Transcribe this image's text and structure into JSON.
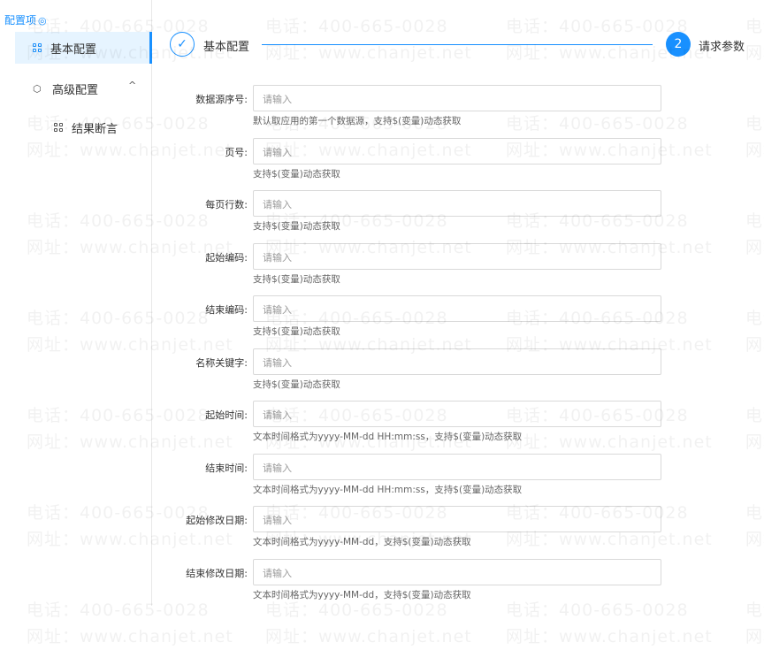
{
  "sidebar": {
    "title": "配置项",
    "items": [
      {
        "label": "基本配置"
      },
      {
        "label": "高级配置"
      },
      {
        "label": "结果断言"
      }
    ]
  },
  "steps": [
    {
      "label": "基本配置",
      "status": "done"
    },
    {
      "number": "2",
      "label": "请求参数",
      "status": "active"
    }
  ],
  "form": {
    "placeholder": "请输入",
    "fields": [
      {
        "label": "数据源序号:",
        "hint": "默认取应用的第一个数据源，支持$(变量)动态获取"
      },
      {
        "label": "页号:",
        "hint": "支持$(变量)动态获取"
      },
      {
        "label": "每页行数:",
        "hint": "支持$(变量)动态获取"
      },
      {
        "label": "起始编码:",
        "hint": "支持$(变量)动态获取"
      },
      {
        "label": "结束编码:",
        "hint": "支持$(变量)动态获取"
      },
      {
        "label": "名称关键字:",
        "hint": "支持$(变量)动态获取"
      },
      {
        "label": "起始时间:",
        "hint": "文本时间格式为yyyy-MM-dd HH:mm:ss，支持$(变量)动态获取"
      },
      {
        "label": "结束时间:",
        "hint": "文本时间格式为yyyy-MM-dd HH:mm:ss，支持$(变量)动态获取"
      },
      {
        "label": "起始修改日期:",
        "hint": "文本时间格式为yyyy-MM-dd，支持$(变量)动态获取"
      },
      {
        "label": "结束修改日期:",
        "hint": "文本时间格式为yyyy-MM-dd，支持$(变量)动态获取"
      }
    ]
  },
  "watermark": {
    "phone": "电话：400-665-0028",
    "site": "网址：www.chanjet.net"
  },
  "colors": {
    "accent": "#1890ff",
    "active_bg": "#e6f4ff"
  }
}
